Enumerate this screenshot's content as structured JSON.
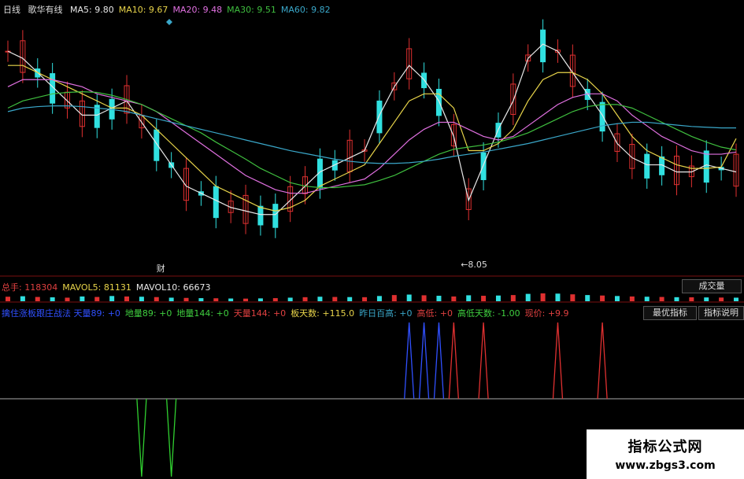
{
  "price_header": {
    "period": "日线",
    "name": "歌华有线",
    "ma": [
      {
        "label": "MA5:",
        "value": "9.80",
        "color": "#e8e8e8"
      },
      {
        "label": "MA10:",
        "value": "9.67",
        "color": "#e8d44a"
      },
      {
        "label": "MA20:",
        "value": "9.48",
        "color": "#e070e0"
      },
      {
        "label": "MA30:",
        "value": "9.51",
        "color": "#3fbf3f"
      },
      {
        "label": "MA60:",
        "value": "9.82",
        "color": "#3aa7c9"
      }
    ]
  },
  "low_marker": "←8.05",
  "finance_marker": "财",
  "volume_header": {
    "items": [
      {
        "label": "总手:",
        "value": "118304",
        "color": "#e04040"
      },
      {
        "label": "MAVOL5:",
        "value": "81131",
        "color": "#e8d44a"
      },
      {
        "label": "MAVOL10:",
        "value": "66673",
        "color": "#e8e8e8"
      }
    ],
    "dropdown": "成交量"
  },
  "indicator_header": {
    "items": [
      {
        "label": "擒住涨板跟庄战法 天量89:",
        "value": "+0",
        "color": "#3050ff"
      },
      {
        "label": "地量89:",
        "value": "+0",
        "color": "#3fcf3f"
      },
      {
        "label": "地量144:",
        "value": "+0",
        "color": "#3fcf3f"
      },
      {
        "label": "天量144:",
        "value": "+0",
        "color": "#e04040"
      },
      {
        "label": "板天数:",
        "value": "+115.0",
        "color": "#e8d44a"
      },
      {
        "label": "昨日百高:",
        "value": "+0",
        "color": "#3aa7c9"
      },
      {
        "label": "高低:",
        "value": "+0",
        "color": "#e04040"
      },
      {
        "label": "高低天数:",
        "value": "-1.00",
        "color": "#3fcf3f"
      },
      {
        "label": "现价:",
        "value": "+9.9",
        "color": "#e04040"
      }
    ],
    "buttons": [
      "最优指标",
      "指标说明"
    ]
  },
  "watermark": {
    "title": "指标公式网",
    "url": "www.zbgs3.com"
  },
  "colors": {
    "up": "#e03030",
    "down": "#30e0e0",
    "grid": "#7a1010",
    "axis": "#aaaaaa"
  },
  "chart_data": {
    "type": "line",
    "series": [
      {
        "name": "MA5",
        "color": "#e8e8e8",
        "values": [
          10.9,
          10.8,
          10.6,
          10.4,
          10.2,
          10.0,
          10.0,
          10.1,
          10.2,
          9.9,
          9.6,
          9.3,
          9.0,
          8.9,
          8.8,
          8.7,
          8.65,
          8.6,
          8.6,
          8.8,
          9.0,
          9.2,
          9.3,
          9.4,
          9.5,
          10.0,
          10.4,
          10.7,
          10.5,
          10.2,
          9.7,
          8.8,
          9.3,
          9.8,
          10.2,
          10.8,
          11.0,
          10.9,
          10.6,
          10.3,
          10.0,
          9.6,
          9.4,
          9.3,
          9.3,
          9.2,
          9.2,
          9.3,
          9.25,
          9.2
        ]
      },
      {
        "name": "MA10",
        "color": "#e8d44a",
        "values": [
          10.7,
          10.7,
          10.6,
          10.5,
          10.4,
          10.3,
          10.2,
          10.1,
          10.1,
          10.0,
          9.8,
          9.6,
          9.4,
          9.2,
          9.0,
          8.9,
          8.8,
          8.7,
          8.65,
          8.7,
          8.8,
          9.0,
          9.1,
          9.2,
          9.3,
          9.6,
          9.9,
          10.2,
          10.3,
          10.3,
          10.1,
          9.5,
          9.5,
          9.6,
          9.8,
          10.2,
          10.5,
          10.6,
          10.6,
          10.5,
          10.3,
          10.0,
          9.7,
          9.5,
          9.4,
          9.3,
          9.25,
          9.25,
          9.27,
          9.67
        ]
      },
      {
        "name": "MA20",
        "color": "#e070e0",
        "values": [
          10.4,
          10.5,
          10.5,
          10.5,
          10.45,
          10.4,
          10.3,
          10.25,
          10.2,
          10.15,
          10.05,
          9.9,
          9.75,
          9.6,
          9.45,
          9.3,
          9.15,
          9.05,
          8.95,
          8.9,
          8.9,
          8.95,
          9.0,
          9.05,
          9.1,
          9.25,
          9.45,
          9.65,
          9.8,
          9.9,
          9.9,
          9.8,
          9.7,
          9.65,
          9.7,
          9.85,
          10.0,
          10.15,
          10.25,
          10.3,
          10.3,
          10.2,
          10.0,
          9.85,
          9.7,
          9.6,
          9.5,
          9.45,
          9.45,
          9.48
        ]
      },
      {
        "name": "MA30",
        "color": "#3fbf3f",
        "values": [
          10.1,
          10.2,
          10.25,
          10.3,
          10.32,
          10.33,
          10.32,
          10.28,
          10.22,
          10.15,
          10.05,
          9.95,
          9.85,
          9.75,
          9.62,
          9.5,
          9.38,
          9.25,
          9.15,
          9.05,
          9.0,
          8.98,
          8.98,
          9.0,
          9.02,
          9.08,
          9.15,
          9.25,
          9.35,
          9.45,
          9.52,
          9.55,
          9.58,
          9.62,
          9.68,
          9.75,
          9.85,
          9.95,
          10.05,
          10.12,
          10.15,
          10.15,
          10.1,
          10.0,
          9.9,
          9.8,
          9.7,
          9.62,
          9.55,
          9.51
        ]
      },
      {
        "name": "MA60",
        "color": "#3aa7c9",
        "values": [
          10.05,
          10.1,
          10.12,
          10.13,
          10.13,
          10.12,
          10.1,
          10.08,
          10.05,
          10.0,
          9.95,
          9.9,
          9.85,
          9.8,
          9.75,
          9.7,
          9.65,
          9.6,
          9.55,
          9.5,
          9.46,
          9.42,
          9.38,
          9.35,
          9.33,
          9.32,
          9.32,
          9.33,
          9.35,
          9.38,
          9.42,
          9.45,
          9.48,
          9.52,
          9.56,
          9.6,
          9.65,
          9.7,
          9.75,
          9.8,
          9.85,
          9.88,
          9.9,
          9.9,
          9.88,
          9.86,
          9.84,
          9.83,
          9.82,
          9.82
        ]
      }
    ],
    "ylim": [
      7.8,
      11.4
    ],
    "volume": [
      38,
      42,
      36,
      33,
      30,
      40,
      36,
      44,
      40,
      38,
      35,
      30,
      28,
      26,
      25,
      23,
      22,
      24,
      26,
      30,
      34,
      38,
      36,
      35,
      34,
      44,
      52,
      56,
      50,
      46,
      40,
      50,
      46,
      48,
      52,
      62,
      66,
      64,
      58,
      52,
      48,
      44,
      40,
      38,
      36,
      34,
      33,
      32,
      31,
      30
    ],
    "indicator": {
      "blue_spikes": [
        27,
        28,
        29
      ],
      "red_spikes": [
        30,
        32,
        37,
        40
      ],
      "green_dips": [
        9,
        11
      ]
    }
  }
}
